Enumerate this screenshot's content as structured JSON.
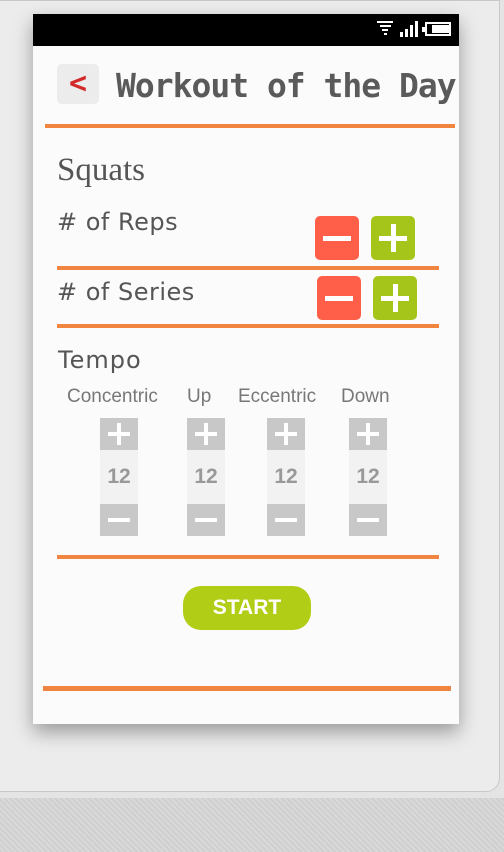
{
  "header": {
    "back_label": "<",
    "title": "Workout of the Day"
  },
  "exercise": {
    "name": "Squats"
  },
  "reps": {
    "label": "# of Reps"
  },
  "series": {
    "label": "# of Series"
  },
  "tempo": {
    "label": "Tempo",
    "columns": [
      {
        "label": "Concentric",
        "value": "12"
      },
      {
        "label": "Up",
        "value": "12"
      },
      {
        "label": "Eccentric",
        "value": "12"
      },
      {
        "label": "Down",
        "value": "12"
      }
    ]
  },
  "actions": {
    "start_label": "START"
  },
  "icons": [
    "wifi-icon",
    "signal-icon",
    "battery-icon",
    "minus-icon",
    "plus-icon"
  ],
  "colors": {
    "accent_rule": "#f08542",
    "minus_button": "#ff5e48",
    "plus_button": "#a6c51a",
    "start_button": "#b2cd16",
    "back_arrow": "#d42a2a"
  }
}
